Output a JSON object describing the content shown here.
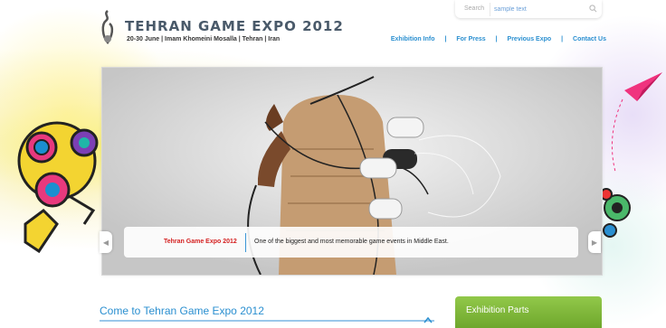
{
  "header": {
    "logo_title": "TEHRAN GAME EXPO 2012",
    "logo_subtitle": "20-30 June | Imam Khomeini Mosalla | Tehran | Iran"
  },
  "search": {
    "label": "Search",
    "placeholder": "sample text"
  },
  "nav": {
    "items": [
      "Exhibition Info",
      "For Press",
      "Previous Expo",
      "Contact Us"
    ]
  },
  "slider": {
    "caption_title": "Tehran Game Expo 2012",
    "caption_text": "One of the biggest and most memorable game events in Middle East.",
    "prev_glyph": "◀",
    "next_glyph": "▶"
  },
  "main": {
    "section_title": "Come to Tehran Game Expo 2012"
  },
  "sidebar": {
    "panel_title": "Exhibition Parts"
  },
  "colors": {
    "link_blue": "#2a8fd0",
    "caption_red": "#d42020",
    "panel_green": "#7ab535"
  }
}
